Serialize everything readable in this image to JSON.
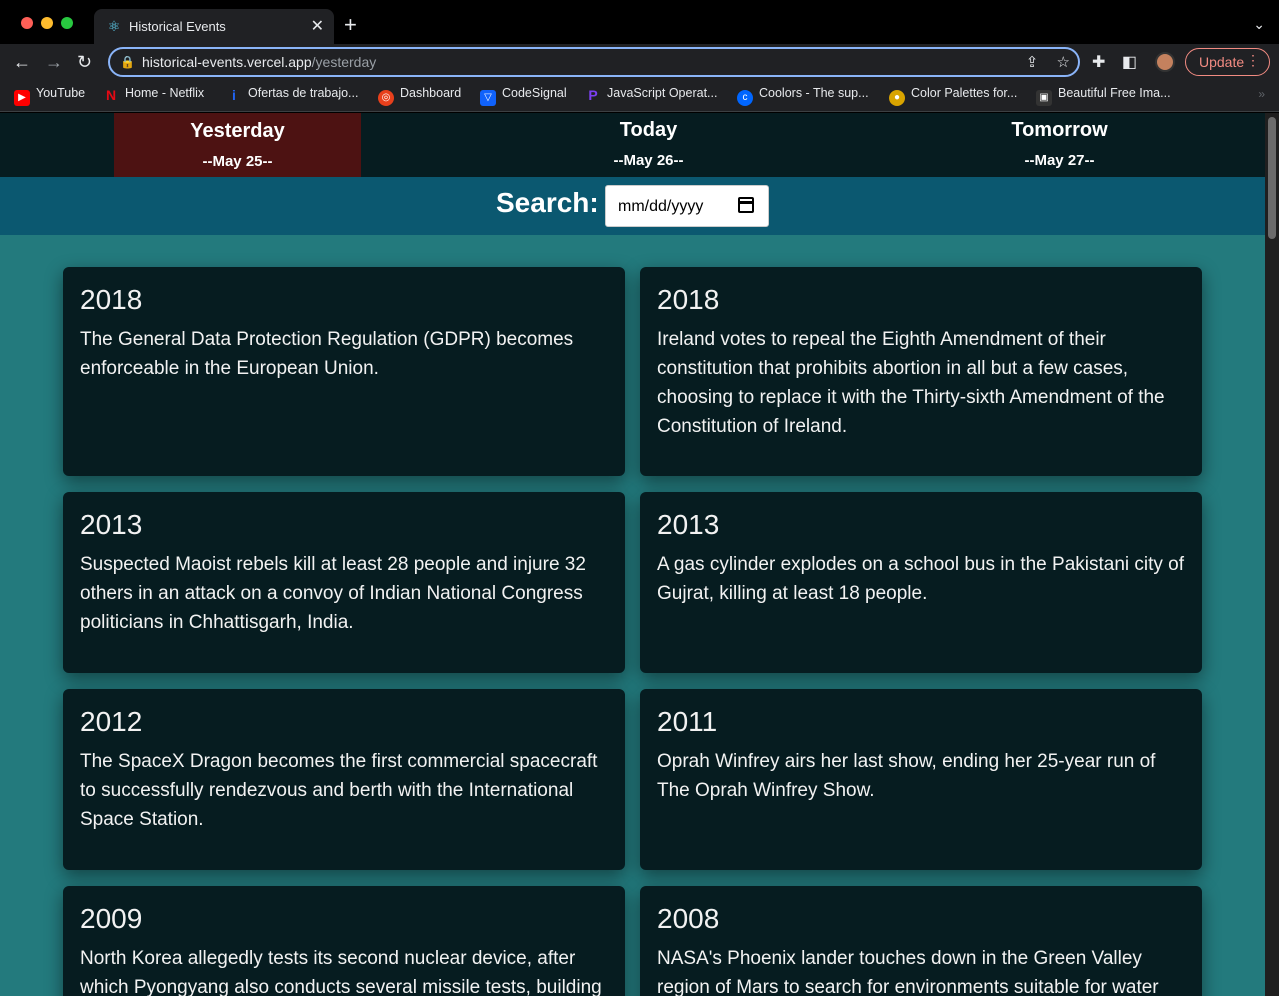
{
  "browser": {
    "tab_title": "Historical Events",
    "url_host": "historical-events.vercel.app",
    "url_path": "/yesterday",
    "update_label": "Update",
    "bookmarks": [
      {
        "label": "YouTube",
        "icon": "youtube-icon",
        "color": "#ff0000"
      },
      {
        "label": "Home - Netflix",
        "icon": "netflix-icon",
        "color": "#e50914"
      },
      {
        "label": "Ofertas de trabajo...",
        "icon": "indeed-icon",
        "color": "#2164f3"
      },
      {
        "label": "Dashboard",
        "icon": "dashboard-icon",
        "color": "#e8401c"
      },
      {
        "label": "CodeSignal",
        "icon": "codesignal-icon",
        "color": "#1062fb"
      },
      {
        "label": "JavaScript Operat...",
        "icon": "js-icon",
        "color": "#7b3ff2"
      },
      {
        "label": "Coolors - The sup...",
        "icon": "coolors-icon",
        "color": "#0066ff"
      },
      {
        "label": "Color Palettes for...",
        "icon": "palette-icon",
        "color": "#d9a400"
      },
      {
        "label": "Beautiful Free Ima...",
        "icon": "unsplash-icon",
        "color": "#222222"
      }
    ]
  },
  "nav": {
    "yesterday": {
      "label": "Yesterday",
      "date": "--May 25--"
    },
    "today": {
      "label": "Today",
      "date": "--May 26--"
    },
    "tomorrow": {
      "label": "Tomorrow",
      "date": "--May 27--"
    }
  },
  "search": {
    "label": "Search:",
    "placeholder": "mm/dd/yyyy"
  },
  "events": [
    {
      "year": "2018",
      "text": "The General Data Protection Regulation (GDPR) becomes enforceable in the European Union."
    },
    {
      "year": "2018",
      "text": "Ireland votes to repeal the Eighth Amendment of their constitution that prohibits abortion in all but a few cases, choosing to replace it with the Thirty-sixth Amendment of the Constitution of Ireland."
    },
    {
      "year": "2013",
      "text": "Suspected Maoist rebels kill at least 28 people and injure 32 others in an attack on a convoy of Indian National Congress politicians in Chhattisgarh, India."
    },
    {
      "year": "2013",
      "text": "A gas cylinder explodes on a school bus in the Pakistani city of Gujrat, killing at least 18 people."
    },
    {
      "year": "2012",
      "text": "The SpaceX Dragon becomes the first commercial spacecraft to successfully rendezvous and berth with the International Space Station."
    },
    {
      "year": "2011",
      "text": "Oprah Winfrey airs her last show, ending her 25-year run of The Oprah Winfrey Show."
    },
    {
      "year": "2009",
      "text": "North Korea allegedly tests its second nuclear device, after which Pyongyang also conducts several missile tests, building"
    },
    {
      "year": "2008",
      "text": "NASA's Phoenix lander touches down in the Green Valley region of Mars to search for environments suitable for water"
    }
  ],
  "colors": {
    "page_bg": "#237a7d",
    "nav_bg": "#061c20",
    "active_tab": "#4d1212",
    "search_bar": "#0b5870",
    "card_bg": "#061c20"
  }
}
